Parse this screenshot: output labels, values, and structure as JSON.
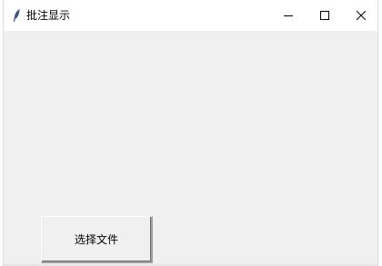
{
  "window": {
    "title": "批注显示",
    "app_icon": "feather-icon",
    "controls": {
      "minimize": "minimize-icon",
      "maximize": "maximize-icon",
      "close": "close-icon"
    }
  },
  "main": {
    "select_file_label": "选择文件"
  }
}
